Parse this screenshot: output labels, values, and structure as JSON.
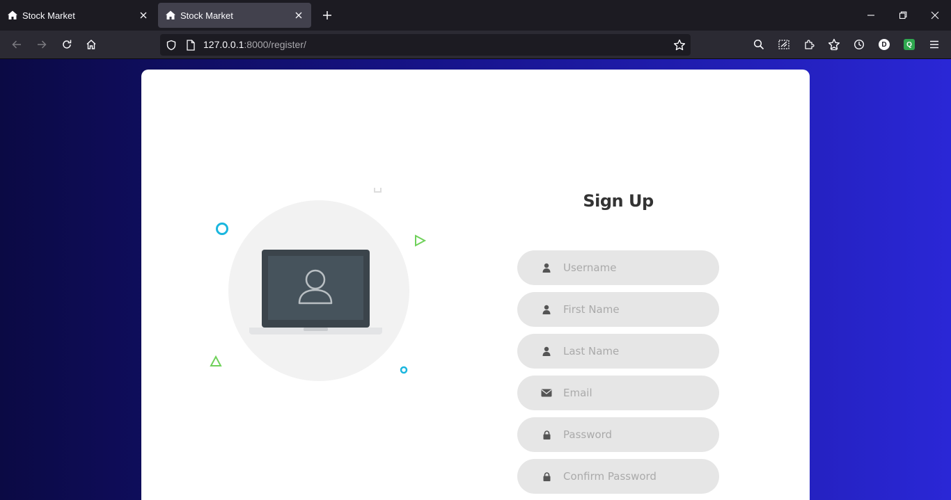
{
  "browser": {
    "tabs": [
      {
        "title": "Stock Market",
        "active": false
      },
      {
        "title": "Stock Market",
        "active": true
      }
    ],
    "url_host": "127.0.0.1",
    "url_rest": ":8000/register/",
    "profile_badge": "D",
    "extension_badge": "Q"
  },
  "form": {
    "title": "Sign Up",
    "fields": [
      {
        "placeholder": "Username",
        "icon": "user-icon"
      },
      {
        "placeholder": "First Name",
        "icon": "user-icon"
      },
      {
        "placeholder": "Last Name",
        "icon": "user-icon"
      },
      {
        "placeholder": "Email",
        "icon": "envelope-icon"
      },
      {
        "placeholder": "Password",
        "icon": "lock-icon"
      },
      {
        "placeholder": "Confirm Password",
        "icon": "lock-icon"
      }
    ]
  },
  "colors": {
    "gradient_start": "#0b0a44",
    "gradient_end": "#2a27d6",
    "card_bg": "#ffffff",
    "input_bg": "#e6e6e6",
    "accent_cyan": "#1ab6de",
    "accent_green": "#6fd15a"
  }
}
